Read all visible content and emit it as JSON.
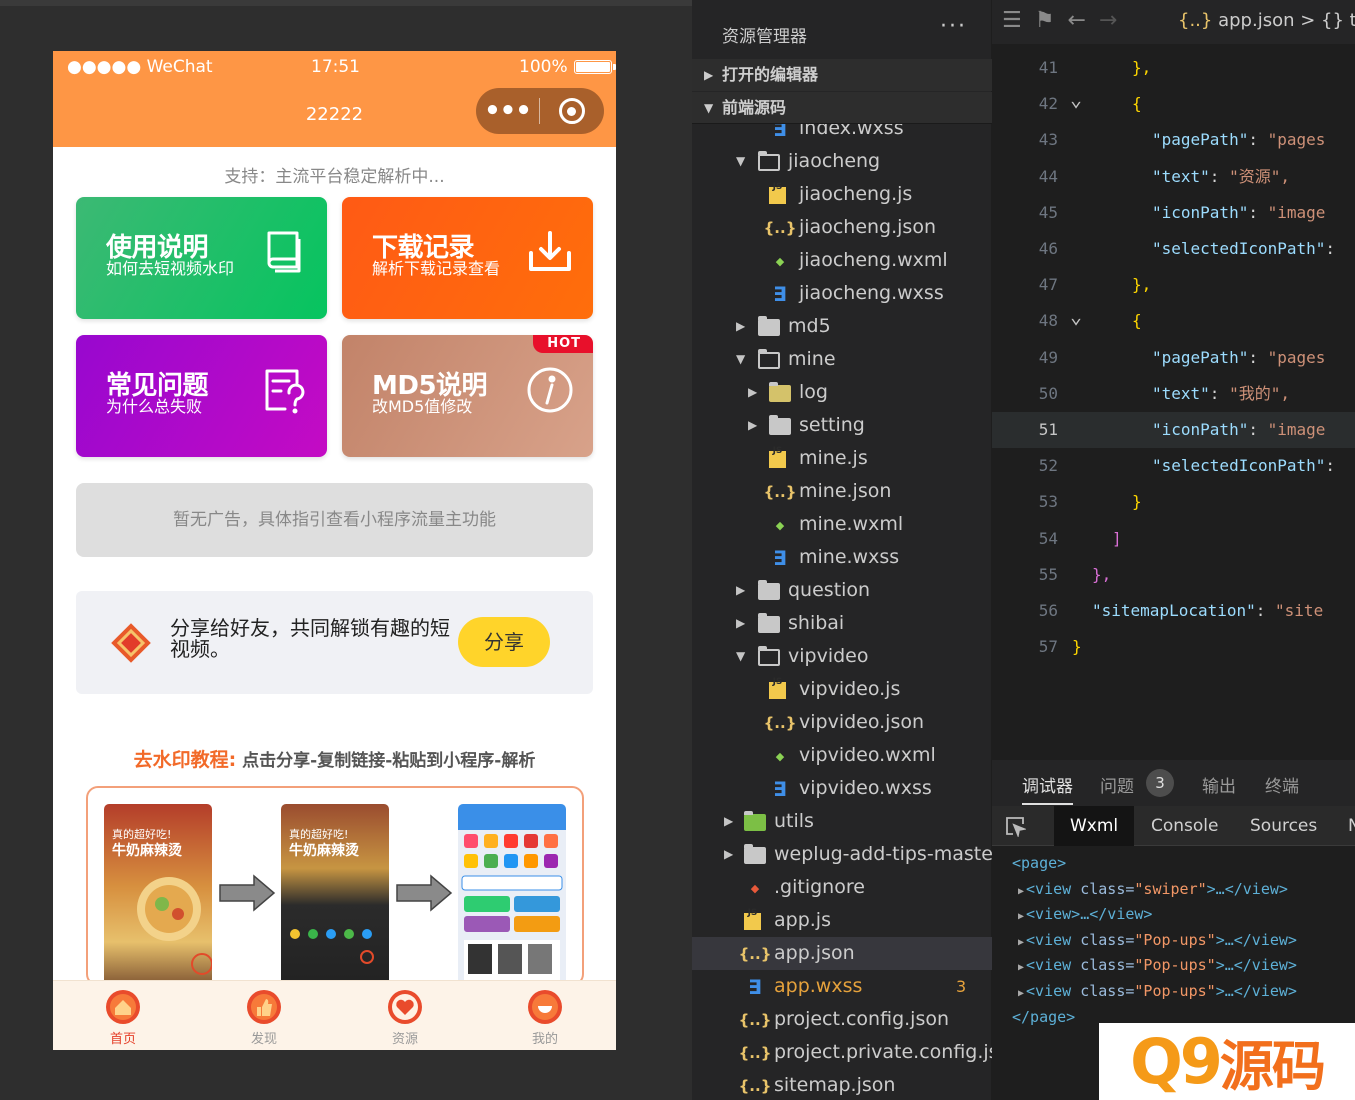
{
  "phone": {
    "status": {
      "carrier": "●●●●● WeChat",
      "time": "17:51",
      "battery": "100%"
    },
    "nav_title": "22222",
    "support_text": "支持：主流平台稳定解析中...",
    "cards": [
      {
        "title": "使用说明",
        "subtitle": "如何去短视频水印",
        "icon": "book-icon"
      },
      {
        "title": "下载记录",
        "subtitle": "解析下载记录查看",
        "icon": "download-icon"
      },
      {
        "title": "常见问题",
        "subtitle": "为什么总失败",
        "icon": "question-doc-icon"
      },
      {
        "title": "MD5说明",
        "subtitle": "改MD5值修改",
        "icon": "info-icon",
        "badge": "HOT"
      }
    ],
    "ad_text": "暂无广告，具体指引查看小程序流量主功能",
    "share": {
      "text": "分享给好友，共同解锁有趣的短视频。",
      "button": "分享"
    },
    "tutorial": {
      "title_highlight": "去水印教程:",
      "title_rest": "点击分享-复制链接-粘贴到小程序-解析",
      "shot_caption_small": "真的超好吃!",
      "shot_caption_big": "牛奶麻辣烫"
    },
    "tabs": [
      {
        "label": "首页",
        "active": true
      },
      {
        "label": "发现",
        "active": false
      },
      {
        "label": "资源",
        "active": false
      },
      {
        "label": "我的",
        "active": false
      }
    ]
  },
  "explorer": {
    "title": "资源管理器",
    "more": "···",
    "sections": [
      "打开的编辑器",
      "前端源码"
    ],
    "tree": [
      {
        "name": "index.wxss",
        "type": "wxss",
        "depth": 2
      },
      {
        "name": "jiaocheng",
        "type": "folder-open",
        "depth": 1
      },
      {
        "name": "jiaocheng.js",
        "type": "js",
        "depth": 2
      },
      {
        "name": "jiaocheng.json",
        "type": "json",
        "depth": 2
      },
      {
        "name": "jiaocheng.wxml",
        "type": "wxml",
        "depth": 2
      },
      {
        "name": "jiaocheng.wxss",
        "type": "wxss",
        "depth": 2
      },
      {
        "name": "md5",
        "type": "folder",
        "depth": 1
      },
      {
        "name": "mine",
        "type": "folder-open",
        "depth": 1
      },
      {
        "name": "log",
        "type": "folder-log",
        "depth": 2
      },
      {
        "name": "setting",
        "type": "folder",
        "depth": 2
      },
      {
        "name": "mine.js",
        "type": "js",
        "depth": 2
      },
      {
        "name": "mine.json",
        "type": "json",
        "depth": 2
      },
      {
        "name": "mine.wxml",
        "type": "wxml",
        "depth": 2
      },
      {
        "name": "mine.wxss",
        "type": "wxss",
        "depth": 2
      },
      {
        "name": "question",
        "type": "folder",
        "depth": 1
      },
      {
        "name": "shibai",
        "type": "folder",
        "depth": 1
      },
      {
        "name": "vipvideo",
        "type": "folder-open",
        "depth": 1
      },
      {
        "name": "vipvideo.js",
        "type": "js",
        "depth": 2
      },
      {
        "name": "vipvideo.json",
        "type": "json",
        "depth": 2
      },
      {
        "name": "vipvideo.wxml",
        "type": "wxml",
        "depth": 2
      },
      {
        "name": "vipvideo.wxss",
        "type": "wxss",
        "depth": 2
      },
      {
        "name": "utils",
        "type": "folder-utils",
        "depth": 0
      },
      {
        "name": "weplug-add-tips-master",
        "type": "folder",
        "depth": 0
      },
      {
        "name": ".gitignore",
        "type": "git",
        "depth": 0
      },
      {
        "name": "app.js",
        "type": "js",
        "depth": 0
      },
      {
        "name": "app.json",
        "type": "json",
        "depth": 0,
        "selected": true
      },
      {
        "name": "app.wxss",
        "type": "wxss",
        "depth": 0,
        "error": "3"
      },
      {
        "name": "project.config.json",
        "type": "json",
        "depth": 0
      },
      {
        "name": "project.private.config.js...",
        "type": "json",
        "depth": 0
      },
      {
        "name": "sitemap.json",
        "type": "json",
        "depth": 0
      }
    ]
  },
  "editor": {
    "breadcrumb_file": "app.json",
    "breadcrumb_rest": "> {} ta",
    "current_line": "51",
    "lines": [
      {
        "n": "41",
        "text": "},"
      },
      {
        "n": "42",
        "text": "{"
      },
      {
        "n": "43",
        "key": "\"pagePath\"",
        "val": "\"pages"
      },
      {
        "n": "44",
        "key": "\"text\"",
        "val": "\"资源\","
      },
      {
        "n": "45",
        "key": "\"iconPath\"",
        "val": "\"image"
      },
      {
        "n": "46",
        "key": "\"selectedIconPath\"",
        "val": ""
      },
      {
        "n": "47",
        "text": "},"
      },
      {
        "n": "48",
        "text": "{"
      },
      {
        "n": "49",
        "key": "\"pagePath\"",
        "val": "\"pages"
      },
      {
        "n": "50",
        "key": "\"text\"",
        "val": "\"我的\","
      },
      {
        "n": "51",
        "key": "\"iconPath\"",
        "val": "\"image"
      },
      {
        "n": "52",
        "key": "\"selectedIconPath\"",
        "val": ""
      },
      {
        "n": "53",
        "text": "}"
      },
      {
        "n": "54",
        "text": "]"
      },
      {
        "n": "55",
        "text": "},"
      },
      {
        "n": "56",
        "key": "\"sitemapLocation\"",
        "val": "\"site"
      },
      {
        "n": "57",
        "text": "}"
      }
    ]
  },
  "devtools": {
    "tabs": [
      "调试器",
      "问题",
      "输出",
      "终端"
    ],
    "problems_count": "3",
    "subtabs": [
      "Wxml",
      "Console",
      "Sources",
      "N"
    ],
    "dom": [
      {
        "text": "<page>"
      },
      {
        "tag": "<view ",
        "attr": "class",
        "value": "\"swiper\"",
        "close": ">…</view>"
      },
      {
        "tag": "<view>…</view>"
      },
      {
        "tag": "<view ",
        "attr": "class",
        "value": "\"Pop-ups\"",
        "close": ">…</view>"
      },
      {
        "tag": "<view ",
        "attr": "class",
        "value": "\"Pop-ups\"",
        "close": ">…</view>"
      },
      {
        "tag": "<view ",
        "attr": "class",
        "value": "\"Pop-ups\"",
        "close": ">…</view>"
      },
      {
        "text": "</page>"
      }
    ]
  },
  "watermark": {
    "q9": "Q9",
    "text": "源码"
  }
}
